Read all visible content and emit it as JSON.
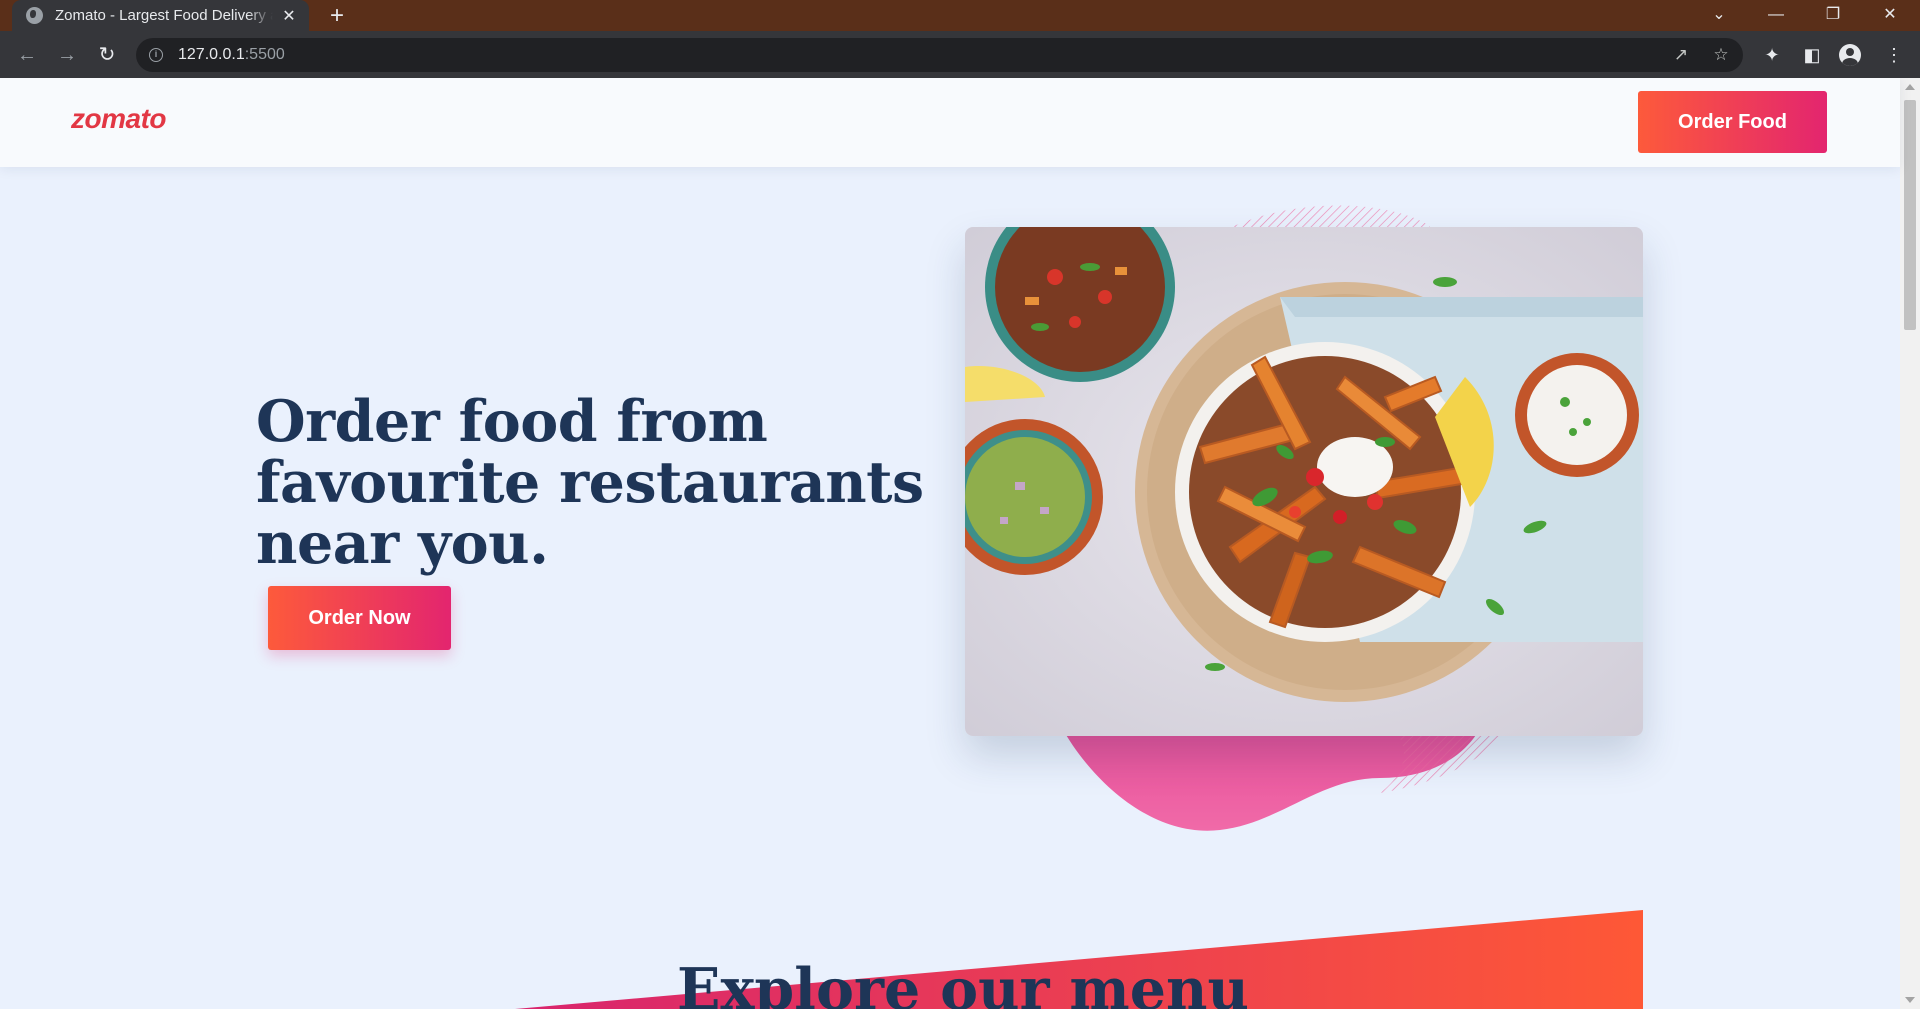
{
  "browser": {
    "tab_title": "Zomato - Largest Food Delivery a",
    "tab_close": "✕",
    "new_tab": "+",
    "url_host": "127.0.0.1",
    "url_port": ":5500",
    "icons": [
      "globe-icon",
      "back-icon",
      "forward-icon",
      "reload-icon",
      "info-icon",
      "share-icon",
      "star-icon",
      "extensions-icon",
      "side-panel-icon",
      "profile-icon",
      "menu-icon",
      "chevron-down-icon",
      "minimize-icon",
      "restore-icon",
      "close-icon"
    ]
  },
  "site": {
    "logo": "zomato",
    "header_button": "Order Food",
    "hero_title": "Order food from favourite restaurants near you.",
    "hero_button": "Order Now",
    "section_title": "Explore our menu"
  },
  "colors": {
    "brand_red": "#e23744",
    "gradient_start": "#fd5a3b",
    "gradient_end": "#e3256f",
    "heading": "#1e3557",
    "page_bg": "#eaf1fd",
    "tabbar_bg": "#5a2f19"
  }
}
